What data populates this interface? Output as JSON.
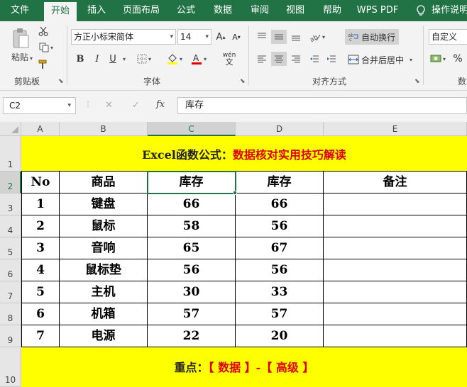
{
  "tabs": [
    "文件",
    "开始",
    "插入",
    "页面布局",
    "公式",
    "数据",
    "审阅",
    "视图",
    "帮助",
    "WPS PDF",
    "操作说明"
  ],
  "ribbon": {
    "clipboard": {
      "paste_label": "粘贴",
      "group_label": "剪贴板"
    },
    "font": {
      "font_name": "方正小标宋简体",
      "font_size": "14",
      "bold": "B",
      "italic": "I",
      "underline": "U",
      "group_label": "字体",
      "wen_glyph": "wén"
    },
    "alignment": {
      "wrap_text_label": "自动换行",
      "merge_center_label": "合并后居中",
      "group_label": "对齐方式"
    },
    "number": {
      "format": "自定义",
      "group_label": "数"
    }
  },
  "formula_bar": {
    "name_box": "C2",
    "cancel_glyph": "✕",
    "enter_glyph": "✓",
    "fx_glyph": "fx",
    "content": "库存"
  },
  "sheet": {
    "columns": [
      "A",
      "B",
      "C",
      "D",
      "E"
    ],
    "rows": [
      "1",
      "2",
      "3",
      "4",
      "5",
      "6",
      "7",
      "8",
      "9",
      "10"
    ],
    "selected_cell": "C2",
    "title": {
      "black": "Excel函数公式：",
      "red": "数据核对实用技巧解读"
    },
    "headers": [
      "No",
      "商品",
      "库存",
      "库存",
      "备注"
    ],
    "data": [
      [
        "1",
        "键盘",
        "66",
        "66",
        ""
      ],
      [
        "2",
        "鼠标",
        "58",
        "56",
        ""
      ],
      [
        "3",
        "音响",
        "65",
        "67",
        ""
      ],
      [
        "4",
        "鼠标垫",
        "56",
        "56",
        ""
      ],
      [
        "5",
        "主机",
        "30",
        "33",
        ""
      ],
      [
        "6",
        "机箱",
        "57",
        "57",
        ""
      ],
      [
        "7",
        "电源",
        "22",
        "20",
        ""
      ]
    ],
    "footer": {
      "black": "重点：",
      "red": "【 数据 】-【 高级 】"
    },
    "highlight_color": "#ffff00",
    "accent_color": "#217346"
  }
}
